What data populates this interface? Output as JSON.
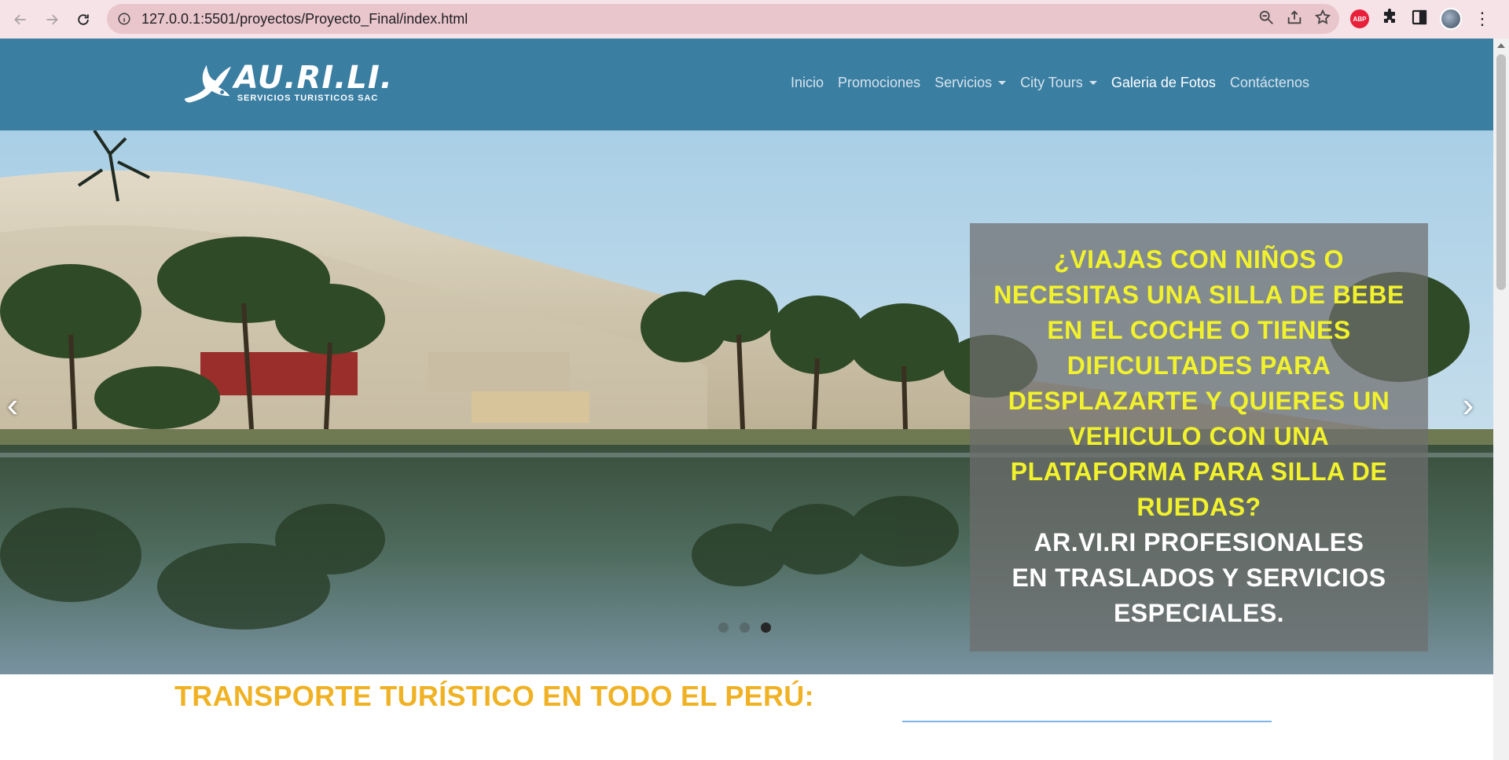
{
  "browser": {
    "url": "127.0.0.1:5501/proyectos/Proyecto_Final/index.html",
    "extension_abp_label": "ABP",
    "icons": [
      "back-icon",
      "forward-icon",
      "reload-icon",
      "site-info-icon",
      "zoom-icon",
      "share-icon",
      "bookmark-star-icon",
      "adblock-icon",
      "extensions-puzzle-icon",
      "side-panel-icon",
      "profile-avatar",
      "more-menu-icon"
    ]
  },
  "site": {
    "logo": {
      "main": "AU.RI.LI.",
      "sub": "SERVICIOS TURISTICOS SAC"
    },
    "menu": [
      {
        "label": "Inicio",
        "dropdown": false,
        "active": false
      },
      {
        "label": "Promociones",
        "dropdown": false,
        "active": false
      },
      {
        "label": "Servicios",
        "dropdown": true,
        "active": false
      },
      {
        "label": "City Tours",
        "dropdown": true,
        "active": false
      },
      {
        "label": "Galeria de Fotos",
        "dropdown": false,
        "active": true
      },
      {
        "label": "Contáctenos",
        "dropdown": false,
        "active": false
      }
    ],
    "colors": {
      "navbar": "#3a7ea2",
      "caption_highlight": "#f2f22c",
      "section_title": "#f0b224"
    }
  },
  "carousel": {
    "prev_label": "‹",
    "next_label": "›",
    "caption_question": "¿VIAJAS CON NIÑOS O NECESITAS UNA SILLA DE BEBE EN EL COCHE O TIENES DIFICULTADES PARA DESPLAZARTE Y QUIERES UN VEHICULO CON UNA PLATAFORMA PARA SILLA DE RUEDAS?",
    "caption_answer_line1": "AR.VI.RI PROFESIONALES",
    "caption_answer_line2": "EN TRASLADOS Y SERVICIOS ESPECIALES.",
    "slide_count": 3,
    "active_slide": 3
  },
  "main": {
    "section_title": "TRANSPORTE TURÍSTICO EN TODO EL PERÚ:"
  }
}
